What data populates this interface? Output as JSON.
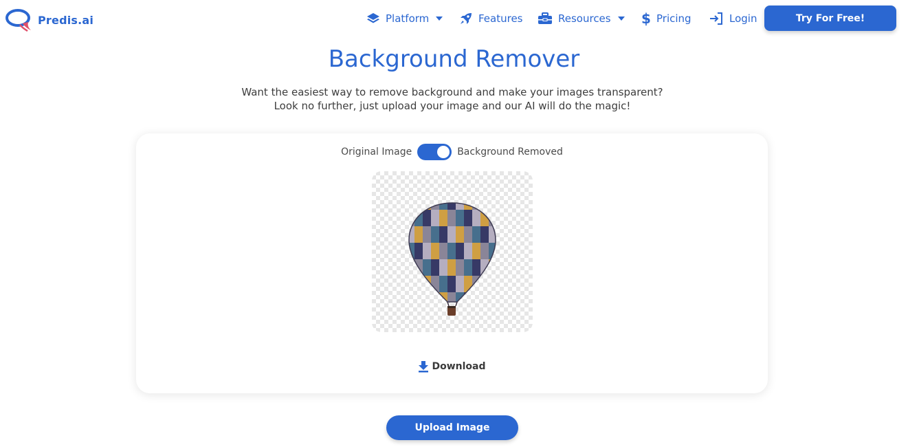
{
  "header": {
    "logo_text": "Predis.ai",
    "nav": [
      {
        "label": "Platform",
        "icon": "layers-icon",
        "has_dropdown": true
      },
      {
        "label": "Features",
        "icon": "rocket-icon",
        "has_dropdown": false
      },
      {
        "label": "Resources",
        "icon": "toolbox-icon",
        "has_dropdown": true
      },
      {
        "label": "Pricing",
        "icon": "dollar-icon",
        "has_dropdown": false
      },
      {
        "label": "Login",
        "icon": "login-icon",
        "has_dropdown": false
      }
    ],
    "cta_label": "Try For Free!"
  },
  "hero": {
    "title": "Background Remover",
    "subtitle_line1": "Want the easiest way to remove background and make your images transparent?",
    "subtitle_line2": "Look no further, just upload your image and our AI will do the magic!"
  },
  "card": {
    "toggle_left_label": "Original Image",
    "toggle_right_label": "Background Removed",
    "toggle_on": true,
    "download_label": "Download"
  },
  "upload_label": "Upload Image",
  "colors": {
    "brand": "#2b67d1",
    "text": "#3a3a3a"
  }
}
